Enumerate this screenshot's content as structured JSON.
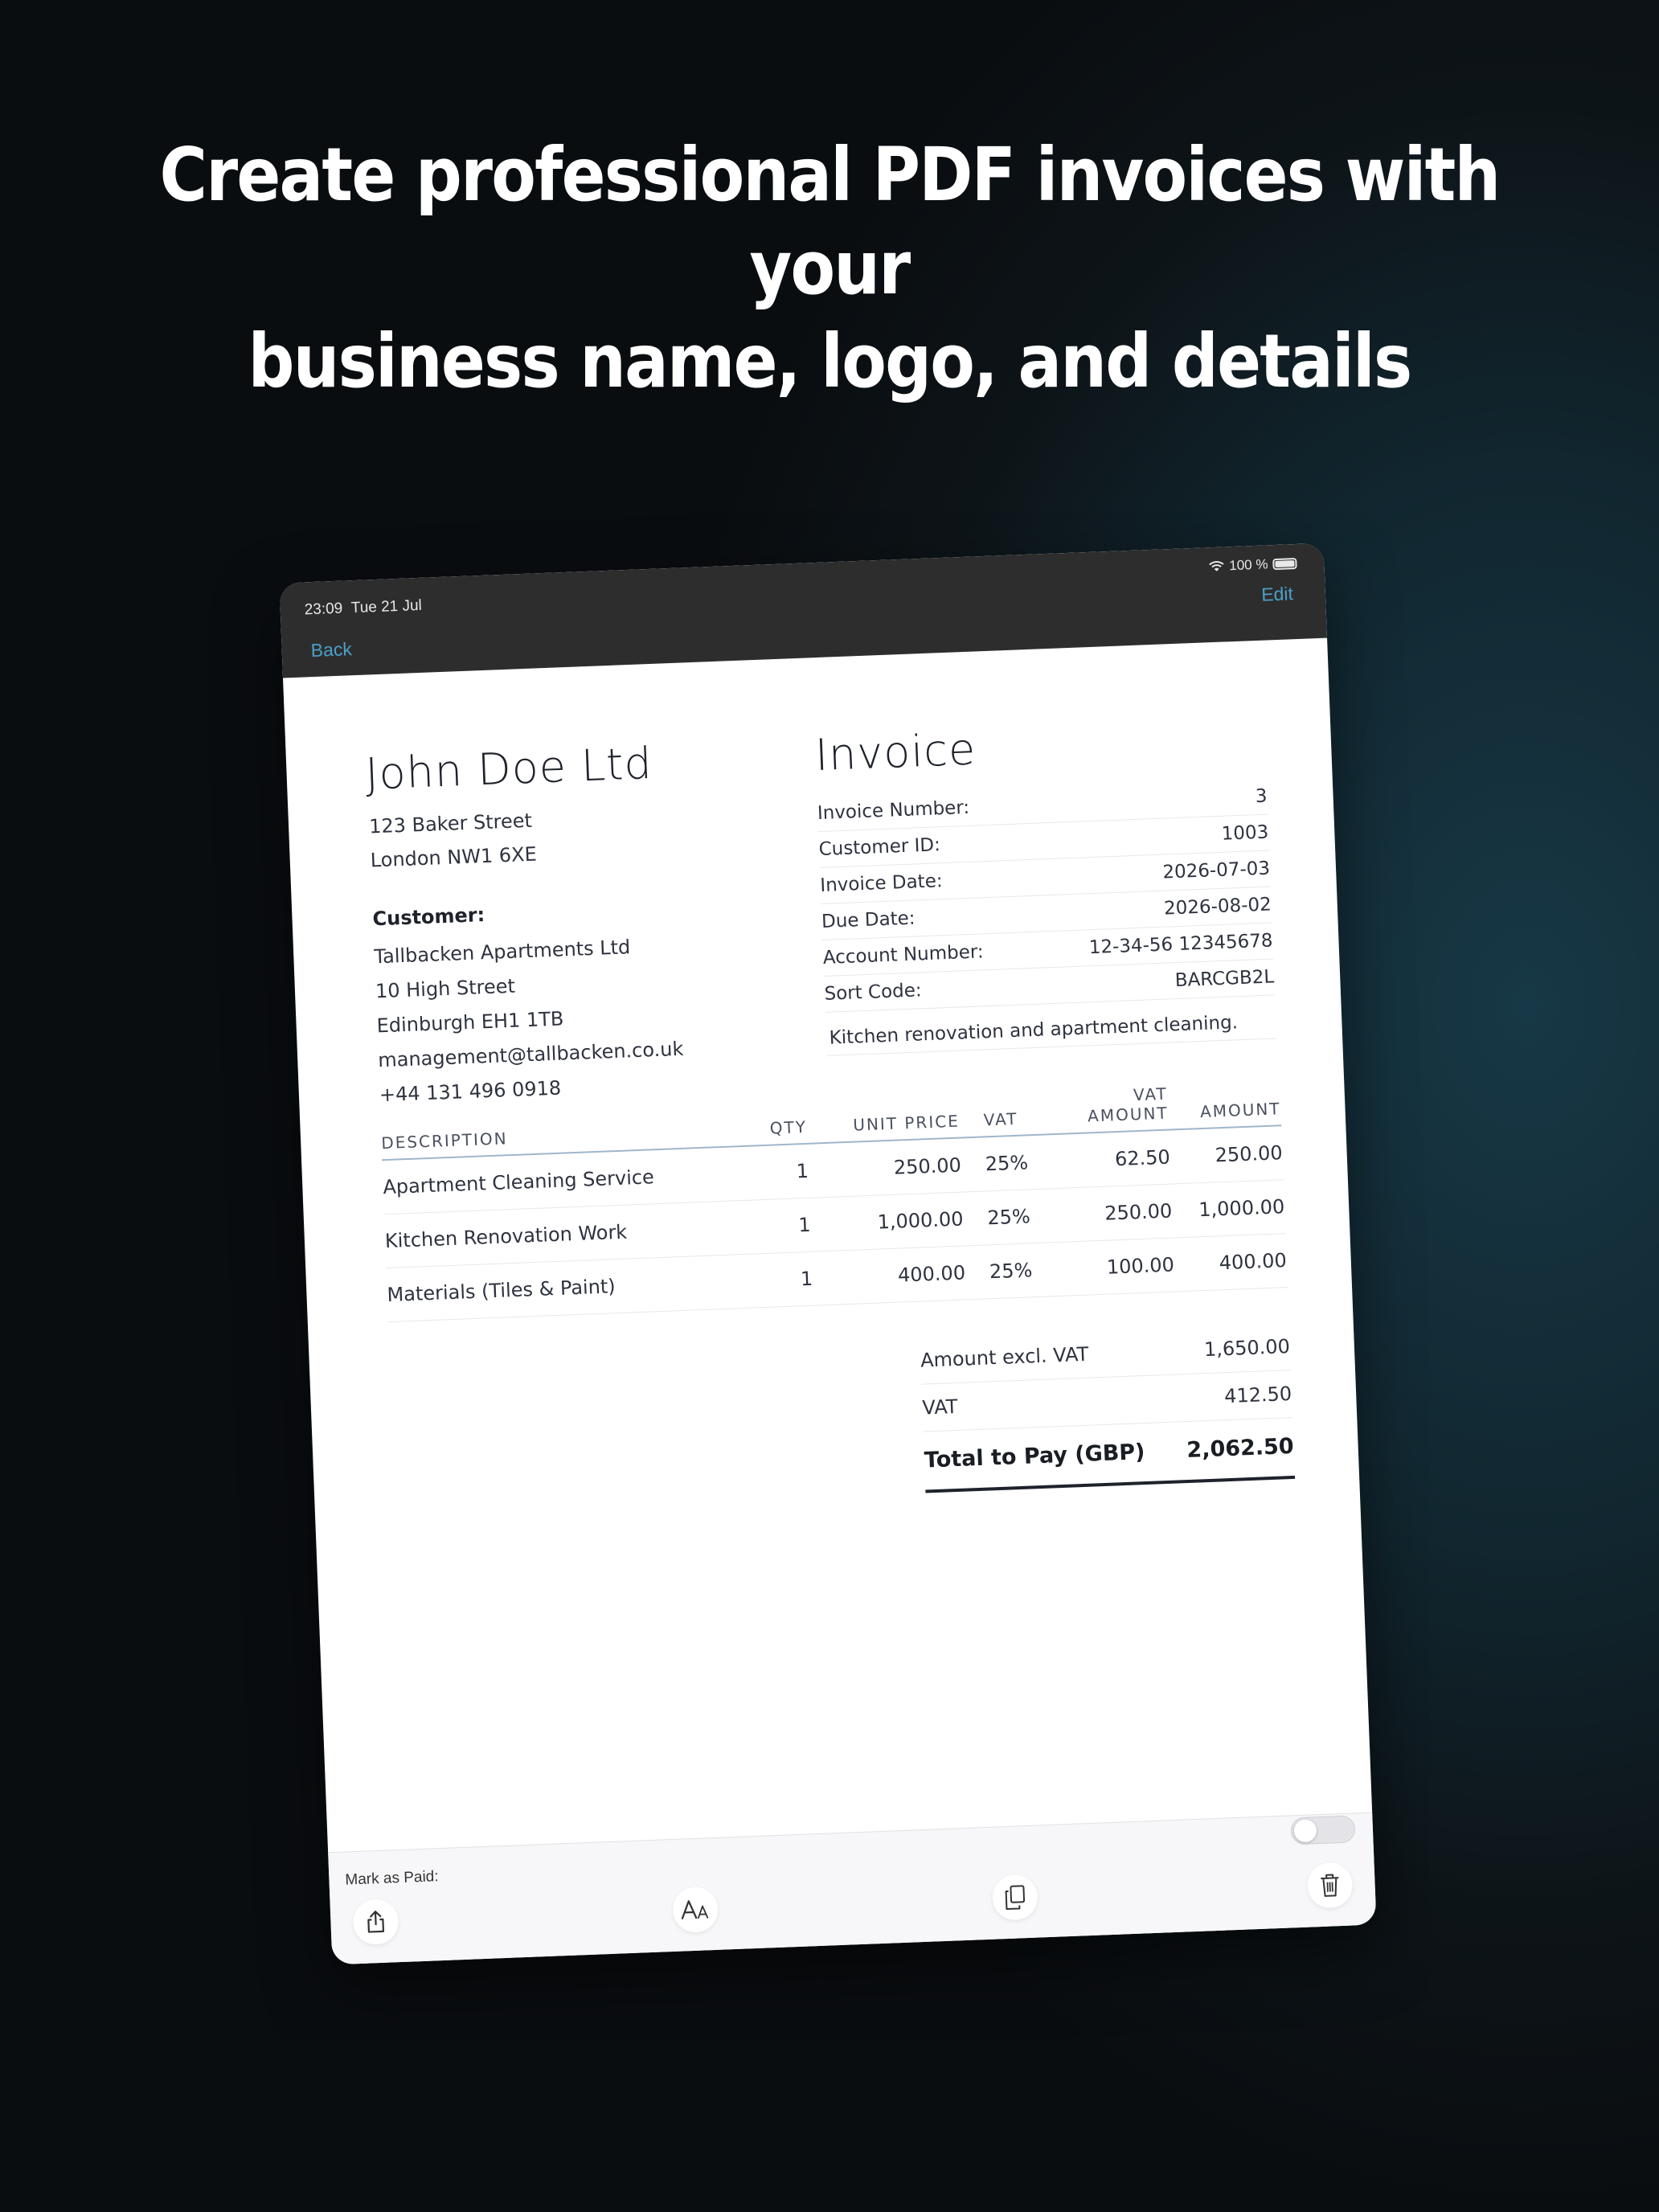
{
  "headline": {
    "line1": "Create professional PDF invoices with your",
    "line2": "business name, logo, and details"
  },
  "status": {
    "time": "23:09",
    "date": "Tue 21 Jul",
    "battery": "100 %"
  },
  "nav": {
    "back": "Back",
    "edit": "Edit"
  },
  "business": {
    "name": "John Doe Ltd",
    "address1": "123 Baker Street",
    "address2": "London NW1 6XE"
  },
  "customer": {
    "label": "Customer:",
    "name": "Tallbacken Apartments Ltd",
    "address1": "10 High Street",
    "address2": "Edinburgh EH1 1TB",
    "email": "management@tallbacken.co.uk",
    "phone": "+44 131 496 0918"
  },
  "invoice": {
    "title": "Invoice",
    "meta": [
      {
        "label": "Invoice Number:",
        "value": "3"
      },
      {
        "label": "Customer ID:",
        "value": "1003"
      },
      {
        "label": "Invoice Date:",
        "value": "2026-07-03"
      },
      {
        "label": "Due Date:",
        "value": "2026-08-02"
      },
      {
        "label": "Account Number:",
        "value": "12-34-56 12345678"
      },
      {
        "label": "Sort Code:",
        "value": "BARCGB2L"
      }
    ],
    "note": "Kitchen renovation and apartment cleaning."
  },
  "items": {
    "headers": {
      "description": "DESCRIPTION",
      "qty": "QTY",
      "unit_price": "UNIT PRICE",
      "vat": "VAT",
      "vat_amount": "VAT AMOUNT",
      "amount": "AMOUNT"
    },
    "rows": [
      {
        "description": "Apartment Cleaning Service",
        "qty": "1",
        "unit_price": "250.00",
        "vat": "25%",
        "vat_amount": "62.50",
        "amount": "250.00"
      },
      {
        "description": "Kitchen Renovation Work",
        "qty": "1",
        "unit_price": "1,000.00",
        "vat": "25%",
        "vat_amount": "250.00",
        "amount": "1,000.00"
      },
      {
        "description": "Materials (Tiles & Paint)",
        "qty": "1",
        "unit_price": "400.00",
        "vat": "25%",
        "vat_amount": "100.00",
        "amount": "400.00"
      }
    ]
  },
  "totals": {
    "excl_label": "Amount excl. VAT",
    "excl_value": "1,650.00",
    "vat_label": "VAT",
    "vat_value": "412.50",
    "total_label": "Total to Pay (GBP)",
    "total_value": "2,062.50"
  },
  "bottom": {
    "paid_label": "Mark as Paid:",
    "paid": false
  },
  "icons": [
    "wifi-icon",
    "battery-icon",
    "share-icon",
    "text-size-icon",
    "copy-icon",
    "trash-icon"
  ]
}
